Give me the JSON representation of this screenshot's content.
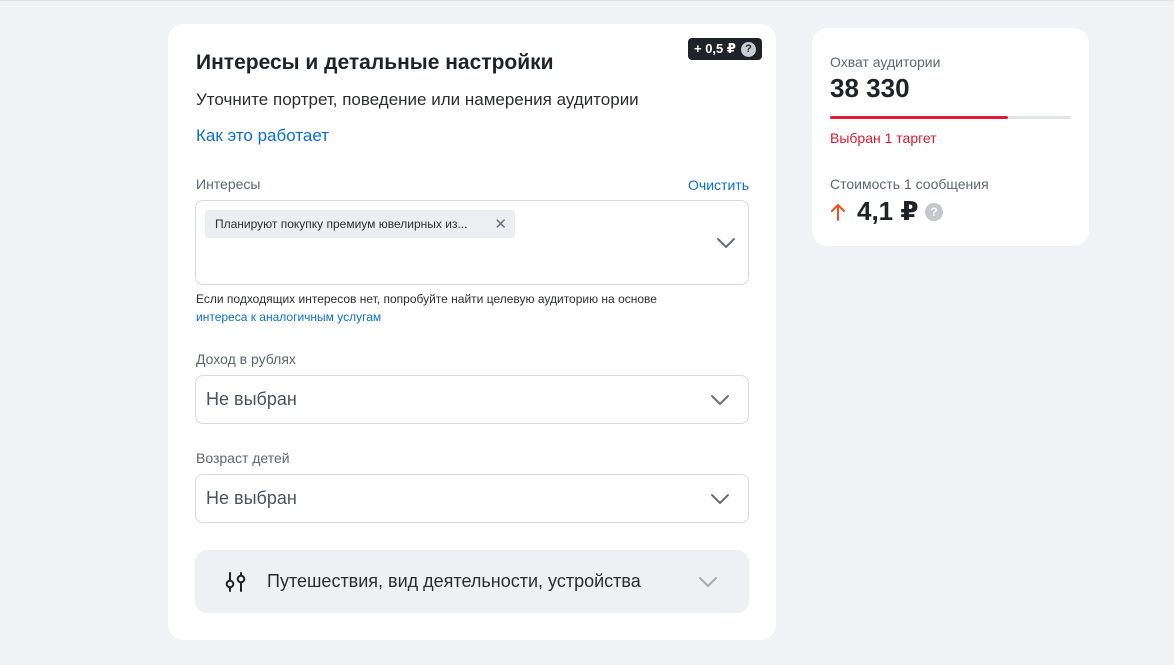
{
  "targeting": {
    "title": "Интересы и детальные настройки",
    "subtitle": "Уточните портрет, поведение или намерения аудитории",
    "how_it_works": "Как это работает",
    "price_badge": "+ 0,5 ₽",
    "interests": {
      "label": "Интересы",
      "clear": "Очистить",
      "chips": [
        "Планируют покупку премиум ювелирных из..."
      ],
      "hint": "Если подходящих интересов нет, попробуйте найти целевую аудиторию на основе",
      "hint_link": "интереса к аналогичным услугам"
    },
    "income": {
      "label": "Доход в рублях",
      "value": "Не выбран"
    },
    "children_age": {
      "label": "Возраст детей",
      "value": "Не выбран"
    },
    "more": {
      "label": "Путешествия, вид деятельности, устройства",
      "icon": "sliders-icon"
    }
  },
  "summary": {
    "reach_label": "Охват аудитории",
    "reach_value": "38 330",
    "reach_progress": 0.74,
    "reach_status": "Выбран 1 таргет",
    "cost_label": "Стоимость 1 сообщения",
    "cost_value": "4,1 ₽",
    "cost_trend_icon": "arrow-up-icon",
    "colors": {
      "accent_red": "#e51937",
      "link_blue": "#0b6fd3",
      "trend_orange": "#e8531f"
    }
  }
}
